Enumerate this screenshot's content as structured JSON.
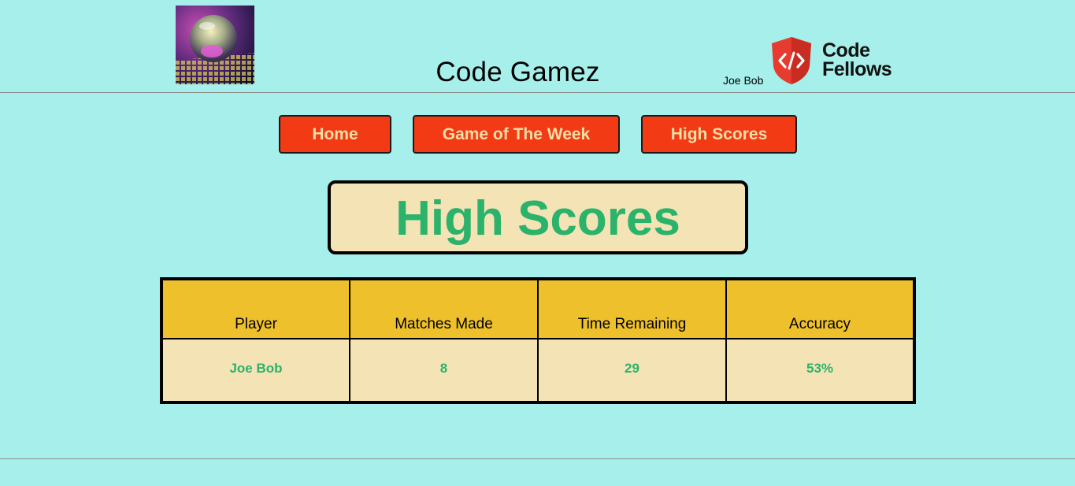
{
  "header": {
    "site_title": "Code Gamez",
    "username": "Joe Bob",
    "logo_icon": "crystal-ball-logo",
    "brand_logo_line1": "Code",
    "brand_logo_line2": "Fellows",
    "brand_logo_icon": "code-shield-icon"
  },
  "nav": {
    "home": "Home",
    "game_of_the_week": "Game of The Week",
    "high_scores": "High Scores"
  },
  "page": {
    "title": "High Scores"
  },
  "scores_table": {
    "columns": [
      "Player",
      "Matches Made",
      "Time Remaining",
      "Accuracy"
    ],
    "rows": [
      [
        "Joe Bob",
        "8",
        "29",
        "53%"
      ]
    ]
  },
  "colors": {
    "background": "#a6efea",
    "nav_button": "#f23a15",
    "nav_text": "#f7dfa6",
    "cream": "#f3e3b5",
    "header_cell": "#eec12c",
    "green_text": "#2bb36b",
    "brand_red": "#e63b2e"
  }
}
